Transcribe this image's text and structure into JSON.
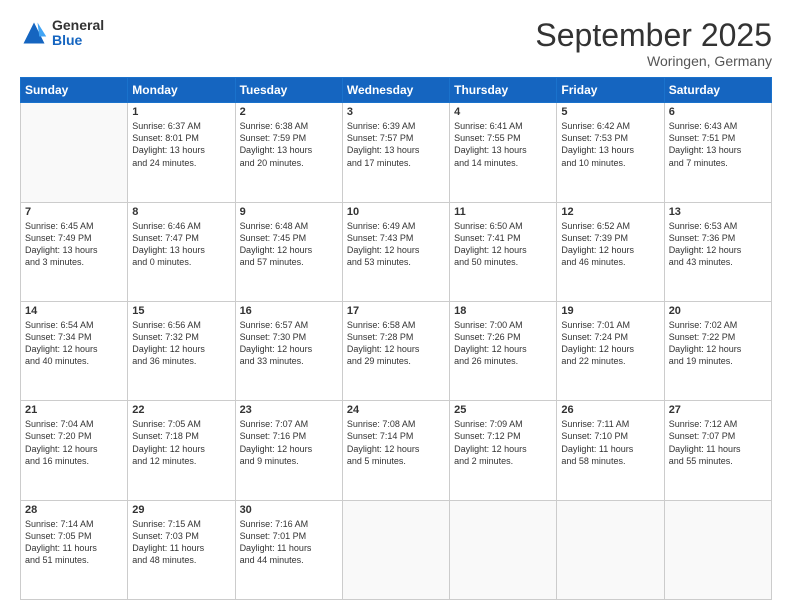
{
  "header": {
    "logo_general": "General",
    "logo_blue": "Blue",
    "month": "September 2025",
    "location": "Woringen, Germany"
  },
  "weekdays": [
    "Sunday",
    "Monday",
    "Tuesday",
    "Wednesday",
    "Thursday",
    "Friday",
    "Saturday"
  ],
  "weeks": [
    [
      {
        "date": "",
        "lines": []
      },
      {
        "date": "1",
        "lines": [
          "Sunrise: 6:37 AM",
          "Sunset: 8:01 PM",
          "Daylight: 13 hours",
          "and 24 minutes."
        ]
      },
      {
        "date": "2",
        "lines": [
          "Sunrise: 6:38 AM",
          "Sunset: 7:59 PM",
          "Daylight: 13 hours",
          "and 20 minutes."
        ]
      },
      {
        "date": "3",
        "lines": [
          "Sunrise: 6:39 AM",
          "Sunset: 7:57 PM",
          "Daylight: 13 hours",
          "and 17 minutes."
        ]
      },
      {
        "date": "4",
        "lines": [
          "Sunrise: 6:41 AM",
          "Sunset: 7:55 PM",
          "Daylight: 13 hours",
          "and 14 minutes."
        ]
      },
      {
        "date": "5",
        "lines": [
          "Sunrise: 6:42 AM",
          "Sunset: 7:53 PM",
          "Daylight: 13 hours",
          "and 10 minutes."
        ]
      },
      {
        "date": "6",
        "lines": [
          "Sunrise: 6:43 AM",
          "Sunset: 7:51 PM",
          "Daylight: 13 hours",
          "and 7 minutes."
        ]
      }
    ],
    [
      {
        "date": "7",
        "lines": [
          "Sunrise: 6:45 AM",
          "Sunset: 7:49 PM",
          "Daylight: 13 hours",
          "and 3 minutes."
        ]
      },
      {
        "date": "8",
        "lines": [
          "Sunrise: 6:46 AM",
          "Sunset: 7:47 PM",
          "Daylight: 13 hours",
          "and 0 minutes."
        ]
      },
      {
        "date": "9",
        "lines": [
          "Sunrise: 6:48 AM",
          "Sunset: 7:45 PM",
          "Daylight: 12 hours",
          "and 57 minutes."
        ]
      },
      {
        "date": "10",
        "lines": [
          "Sunrise: 6:49 AM",
          "Sunset: 7:43 PM",
          "Daylight: 12 hours",
          "and 53 minutes."
        ]
      },
      {
        "date": "11",
        "lines": [
          "Sunrise: 6:50 AM",
          "Sunset: 7:41 PM",
          "Daylight: 12 hours",
          "and 50 minutes."
        ]
      },
      {
        "date": "12",
        "lines": [
          "Sunrise: 6:52 AM",
          "Sunset: 7:39 PM",
          "Daylight: 12 hours",
          "and 46 minutes."
        ]
      },
      {
        "date": "13",
        "lines": [
          "Sunrise: 6:53 AM",
          "Sunset: 7:36 PM",
          "Daylight: 12 hours",
          "and 43 minutes."
        ]
      }
    ],
    [
      {
        "date": "14",
        "lines": [
          "Sunrise: 6:54 AM",
          "Sunset: 7:34 PM",
          "Daylight: 12 hours",
          "and 40 minutes."
        ]
      },
      {
        "date": "15",
        "lines": [
          "Sunrise: 6:56 AM",
          "Sunset: 7:32 PM",
          "Daylight: 12 hours",
          "and 36 minutes."
        ]
      },
      {
        "date": "16",
        "lines": [
          "Sunrise: 6:57 AM",
          "Sunset: 7:30 PM",
          "Daylight: 12 hours",
          "and 33 minutes."
        ]
      },
      {
        "date": "17",
        "lines": [
          "Sunrise: 6:58 AM",
          "Sunset: 7:28 PM",
          "Daylight: 12 hours",
          "and 29 minutes."
        ]
      },
      {
        "date": "18",
        "lines": [
          "Sunrise: 7:00 AM",
          "Sunset: 7:26 PM",
          "Daylight: 12 hours",
          "and 26 minutes."
        ]
      },
      {
        "date": "19",
        "lines": [
          "Sunrise: 7:01 AM",
          "Sunset: 7:24 PM",
          "Daylight: 12 hours",
          "and 22 minutes."
        ]
      },
      {
        "date": "20",
        "lines": [
          "Sunrise: 7:02 AM",
          "Sunset: 7:22 PM",
          "Daylight: 12 hours",
          "and 19 minutes."
        ]
      }
    ],
    [
      {
        "date": "21",
        "lines": [
          "Sunrise: 7:04 AM",
          "Sunset: 7:20 PM",
          "Daylight: 12 hours",
          "and 16 minutes."
        ]
      },
      {
        "date": "22",
        "lines": [
          "Sunrise: 7:05 AM",
          "Sunset: 7:18 PM",
          "Daylight: 12 hours",
          "and 12 minutes."
        ]
      },
      {
        "date": "23",
        "lines": [
          "Sunrise: 7:07 AM",
          "Sunset: 7:16 PM",
          "Daylight: 12 hours",
          "and 9 minutes."
        ]
      },
      {
        "date": "24",
        "lines": [
          "Sunrise: 7:08 AM",
          "Sunset: 7:14 PM",
          "Daylight: 12 hours",
          "and 5 minutes."
        ]
      },
      {
        "date": "25",
        "lines": [
          "Sunrise: 7:09 AM",
          "Sunset: 7:12 PM",
          "Daylight: 12 hours",
          "and 2 minutes."
        ]
      },
      {
        "date": "26",
        "lines": [
          "Sunrise: 7:11 AM",
          "Sunset: 7:10 PM",
          "Daylight: 11 hours",
          "and 58 minutes."
        ]
      },
      {
        "date": "27",
        "lines": [
          "Sunrise: 7:12 AM",
          "Sunset: 7:07 PM",
          "Daylight: 11 hours",
          "and 55 minutes."
        ]
      }
    ],
    [
      {
        "date": "28",
        "lines": [
          "Sunrise: 7:14 AM",
          "Sunset: 7:05 PM",
          "Daylight: 11 hours",
          "and 51 minutes."
        ]
      },
      {
        "date": "29",
        "lines": [
          "Sunrise: 7:15 AM",
          "Sunset: 7:03 PM",
          "Daylight: 11 hours",
          "and 48 minutes."
        ]
      },
      {
        "date": "30",
        "lines": [
          "Sunrise: 7:16 AM",
          "Sunset: 7:01 PM",
          "Daylight: 11 hours",
          "and 44 minutes."
        ]
      },
      {
        "date": "",
        "lines": []
      },
      {
        "date": "",
        "lines": []
      },
      {
        "date": "",
        "lines": []
      },
      {
        "date": "",
        "lines": []
      }
    ]
  ]
}
